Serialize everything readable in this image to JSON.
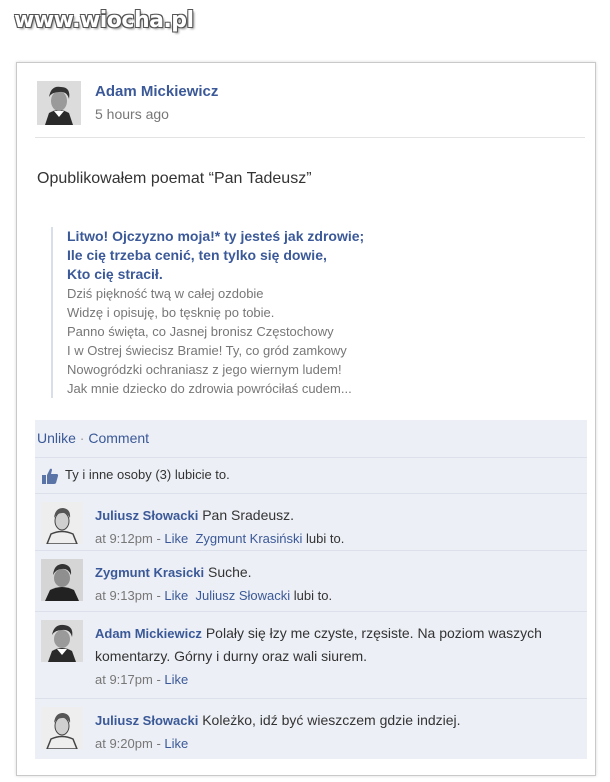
{
  "watermark": "www.wiocha.pl",
  "post": {
    "author": "Adam Mickiewicz",
    "time": "5 hours ago",
    "status": "Opublikowałem poemat “Pan Tadeusz”",
    "quote_bold": [
      "Litwo! Ojczyzno moja!* ty jesteś jak zdrowie;",
      "Ile cię trzeba cenić, ten tylko się dowie,",
      "Kto cię stracił."
    ],
    "quote_gray": [
      "Dziś piękność twą w całej ozdobie",
      "Widzę i opisuję, bo tęsknię po tobie.",
      "Panno święta, co Jasnej bronisz Częstochowy",
      "I w Ostrej świecisz Bramie! Ty, co gród zamkowy",
      "Nowogródzki ochraniasz z jego wiernym ludem!",
      "Jak mnie dziecko do zdrowia powróciłaś cudem..."
    ],
    "unlike_label": "Unlike",
    "dot": "·",
    "comment_label": "Comment",
    "likes_text": "Ty i inne osoby (3) lubicie to."
  },
  "comments": [
    {
      "author": "Juliusz Słowacki",
      "text": "Pan Sradeusz.",
      "time": "at 9:12pm",
      "like_label": "Like",
      "liked_by": "Zygmunt Krasiński",
      "liked_suffix": "lubi to."
    },
    {
      "author": "Zygmunt Krasicki",
      "text": "Suche.",
      "time": "at 9:13pm",
      "like_label": "Like",
      "liked_by": "Juliusz Słowacki",
      "liked_suffix": "lubi to."
    },
    {
      "author": "Adam Mickiewicz",
      "text": "Polały się łzy me czyste, rzęsiste. Na poziom waszych komentarzy. Górny i durny oraz wali siurem.",
      "time": "at 9:17pm",
      "like_label": "Like",
      "liked_by": "",
      "liked_suffix": ""
    },
    {
      "author": "Juliusz Słowacki",
      "text": "Koleżko, idź być wieszczem gdzie indziej.",
      "time": "at 9:20pm",
      "like_label": "Like",
      "liked_by": "",
      "liked_suffix": ""
    }
  ],
  "icons": {
    "avatar": "portrait-avatar",
    "thumb": "thumbs-up-icon"
  },
  "colors": {
    "link": "#3b5998",
    "feed_bg": "#eceff5",
    "muted": "#777777"
  }
}
